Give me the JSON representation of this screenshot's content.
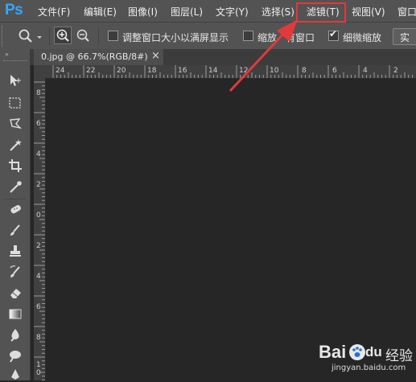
{
  "menubar": {
    "logo": "Ps",
    "items": [
      {
        "label": "文件(F)"
      },
      {
        "label": "编辑(E)"
      },
      {
        "label": "图像(I)"
      },
      {
        "label": "图层(L)"
      },
      {
        "label": "文字(Y)"
      },
      {
        "label": "选择(S)"
      },
      {
        "label": "滤镜(T)"
      },
      {
        "label": "视图(V)"
      },
      {
        "label": "窗口"
      }
    ]
  },
  "options": {
    "resize_windows_label": "调整窗口大小以满屏显示",
    "resize_windows_checked": false,
    "zoom_all_label_part1": "缩放",
    "zoom_all_label_part2": "有窗口",
    "zoom_all_checked": false,
    "scrubby_label": "细微缩放",
    "scrubby_checked": true,
    "actual_pixels_label": "实"
  },
  "document": {
    "tab_title": "0.jpg @ 66.7%(RGB/8#)",
    "close_glyph": "×"
  },
  "rulers": {
    "top": [
      "24",
      "22",
      "20",
      "18",
      "16",
      "14",
      "12",
      "10",
      "8",
      "6",
      "4",
      "2"
    ],
    "left": [
      "8",
      "6",
      "4",
      "2",
      "0",
      "2",
      "4",
      "6",
      "8",
      "1",
      "0"
    ]
  },
  "watermark": {
    "brand": "Bai",
    "brand_suffix": "du",
    "cn": "经验",
    "url": "jingyan.baidu.com"
  },
  "colors": {
    "highlight": "#e03a3a",
    "logo": "#31a8ff"
  }
}
